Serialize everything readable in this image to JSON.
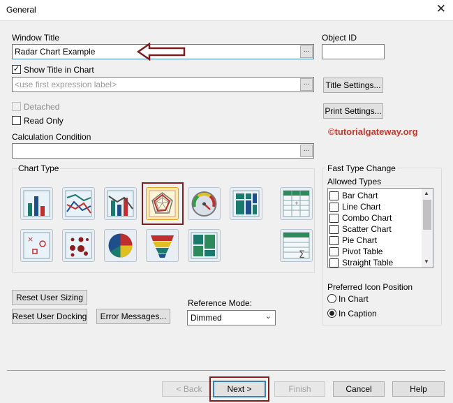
{
  "window": {
    "title": "General"
  },
  "window_title": {
    "label": "Window Title",
    "value": "Radar Chart Example"
  },
  "object_id": {
    "label": "Object ID",
    "value": ""
  },
  "show_title": {
    "label": "Show Title in Chart",
    "checked": true
  },
  "title_expr": {
    "placeholder": "<use first expression label>"
  },
  "title_settings_button": "Title Settings...",
  "print_settings_button": "Print Settings...",
  "detached": {
    "label": "Detached",
    "checked": false,
    "disabled": true
  },
  "read_only": {
    "label": "Read Only",
    "checked": false
  },
  "calc_condition": {
    "label": "Calculation Condition",
    "value": ""
  },
  "watermark": "©tutorialgateway.org",
  "chart_type": {
    "label": "Chart Type",
    "selected": "radar-chart",
    "icons": [
      "bar-chart",
      "line-chart",
      "combo-chart",
      "radar-chart",
      "gauge-chart",
      "block-chart",
      "pivot-table",
      "scatter-chart",
      "grid-chart",
      "pie-chart",
      "funnel-chart",
      "mekko-chart",
      "straight-table"
    ]
  },
  "fast_type_change": {
    "label": "Fast Type Change",
    "allowed_label": "Allowed Types",
    "items": [
      "Bar Chart",
      "Line Chart",
      "Combo Chart",
      "Scatter Chart",
      "Pie Chart",
      "Pivot Table",
      "Straight Table"
    ],
    "preferred_label": "Preferred Icon Position",
    "in_chart": "In Chart",
    "in_caption": "In Caption",
    "selected_position": "In Caption"
  },
  "reset_user_sizing": "Reset User Sizing",
  "reset_user_docking": "Reset User Docking",
  "error_messages": "Error Messages...",
  "reference_mode": {
    "label": "Reference Mode:",
    "value": "Dimmed"
  },
  "footer": {
    "back": "< Back",
    "next": "Next >",
    "finish": "Finish",
    "cancel": "Cancel",
    "help": "Help"
  },
  "colors": {
    "annotation": "#7a1f1f",
    "watermark": "#c0392b",
    "focus": "#3c7fb1"
  }
}
